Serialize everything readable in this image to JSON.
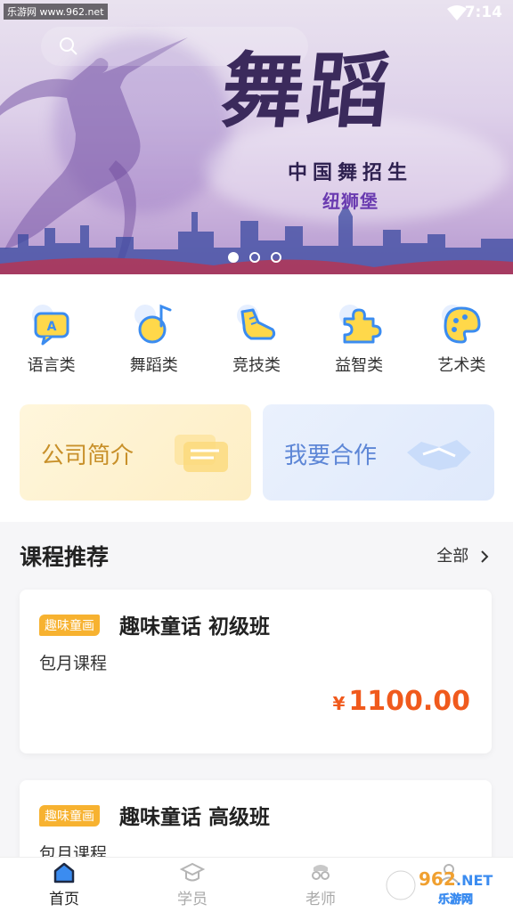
{
  "status_bar": {
    "site_badge": "乐游网 www.962.net",
    "time": "7:14"
  },
  "banner": {
    "title": "舞蹈",
    "subtitle": "中国舞招生",
    "subtitle2": "纽狮堡",
    "page_count": 3,
    "active_page": 1
  },
  "categories": [
    {
      "label": "语言类",
      "icon": "language-icon"
    },
    {
      "label": "舞蹈类",
      "icon": "dance-note-icon"
    },
    {
      "label": "竞技类",
      "icon": "sneaker-icon"
    },
    {
      "label": "益智类",
      "icon": "puzzle-icon"
    },
    {
      "label": "艺术类",
      "icon": "palette-icon"
    }
  ],
  "cards": {
    "company_intro": "公司简介",
    "cooperate": "我要合作"
  },
  "courses_section": {
    "title": "课程推荐",
    "more": "全部",
    "items": [
      {
        "tag": "趣味童画",
        "name": "趣味童话 初级班",
        "subtitle": "包月课程",
        "currency": "¥",
        "price": "1100.00"
      },
      {
        "tag": "趣味童画",
        "name": "趣味童话 高级班",
        "subtitle": "包月课程"
      }
    ]
  },
  "bottom_nav": [
    {
      "label": "首页",
      "icon": "home-icon",
      "active": true
    },
    {
      "label": "学员",
      "icon": "graduation-cap-icon",
      "active": false
    },
    {
      "label": "老师",
      "icon": "teacher-icon",
      "active": false
    },
    {
      "label": "",
      "icon": "profile-icon",
      "active": false
    }
  ],
  "watermark": "962.NET 乐游网",
  "colors": {
    "accent": "#f05a1d",
    "tag": "#f7b230",
    "icon_blue": "#3b8cf0",
    "icon_yellow": "#ffd84a"
  }
}
